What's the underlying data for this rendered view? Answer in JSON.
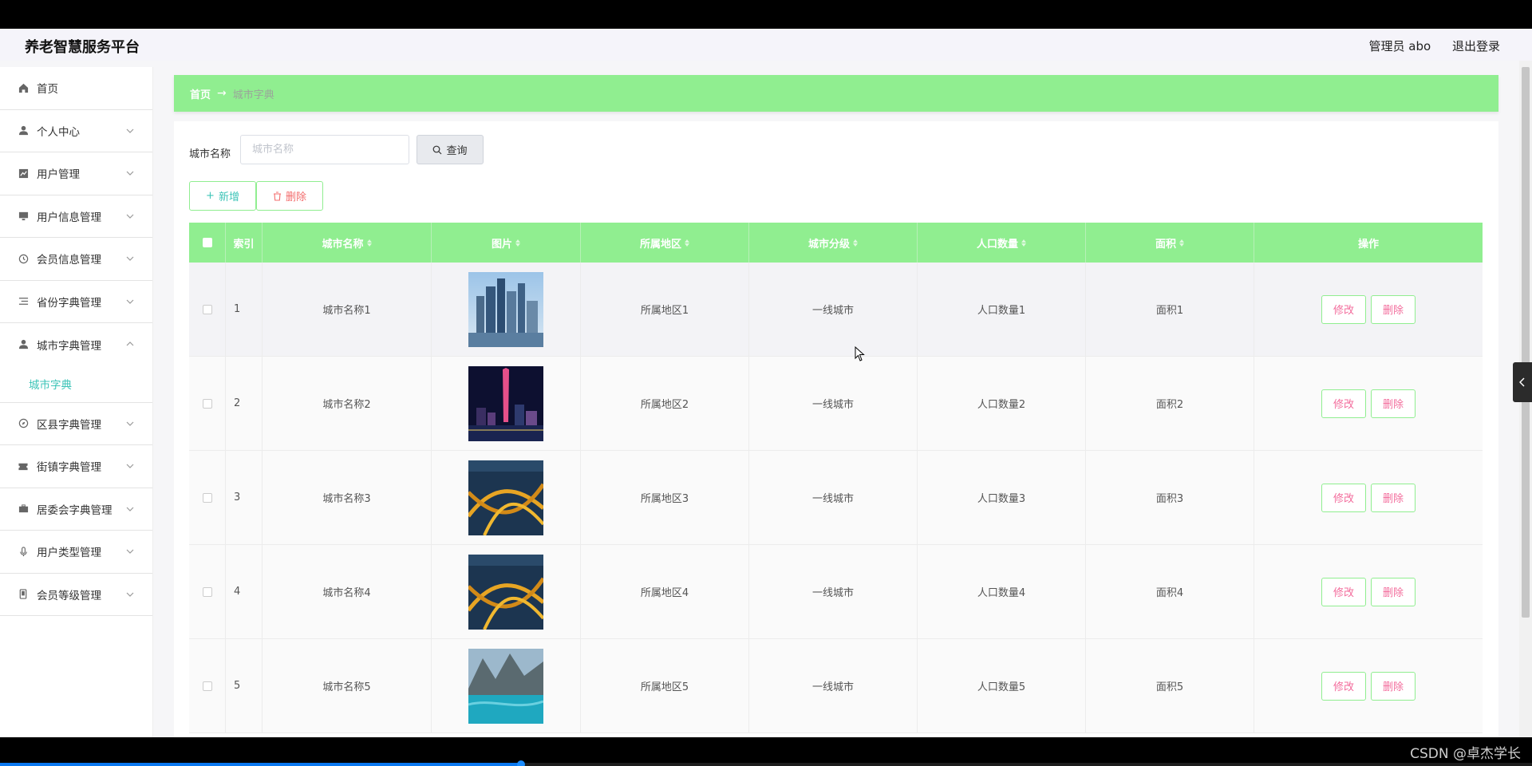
{
  "header": {
    "brand": "养老智慧服务平台",
    "admin_label": "管理员 abo",
    "logout_label": "退出登录"
  },
  "sidebar": {
    "items": [
      {
        "label": "首页",
        "icon": "home-icon"
      },
      {
        "label": "个人中心",
        "icon": "user-icon"
      },
      {
        "label": "用户管理",
        "icon": "chart-icon"
      },
      {
        "label": "用户信息管理",
        "icon": "monitor-icon"
      },
      {
        "label": "会员信息管理",
        "icon": "clock-icon"
      },
      {
        "label": "省份字典管理",
        "icon": "list-icon"
      },
      {
        "label": "城市字典管理",
        "icon": "user-icon"
      },
      {
        "label": "区县字典管理",
        "icon": "compass-icon"
      },
      {
        "label": "街镇字典管理",
        "icon": "ticket-icon"
      },
      {
        "label": "居委会字典管理",
        "icon": "briefcase-icon"
      },
      {
        "label": "用户类型管理",
        "icon": "mic-icon"
      },
      {
        "label": "会员等级管理",
        "icon": "phone-icon"
      }
    ],
    "submenu": {
      "label": "城市字典"
    }
  },
  "breadcrumb": {
    "home": "首页",
    "separator": "→",
    "current": "城市字典"
  },
  "search": {
    "label": "城市名称",
    "placeholder": "城市名称",
    "query_label": "查询"
  },
  "actions": {
    "add_label": "新增",
    "delete_label": "删除"
  },
  "table": {
    "headers": [
      "索引",
      "城市名称",
      "图片",
      "所属地区",
      "城市分级",
      "人口数量",
      "面积",
      "操作"
    ],
    "edit_label": "修改",
    "delete_label": "删除",
    "rows": [
      {
        "index": "1",
        "name": "城市名称1",
        "region": "所属地区1",
        "level": "一线城市",
        "population": "人口数量1",
        "area": "面积1"
      },
      {
        "index": "2",
        "name": "城市名称2",
        "region": "所属地区2",
        "level": "一线城市",
        "population": "人口数量2",
        "area": "面积2"
      },
      {
        "index": "3",
        "name": "城市名称3",
        "region": "所属地区3",
        "level": "一线城市",
        "population": "人口数量3",
        "area": "面积3"
      },
      {
        "index": "4",
        "name": "城市名称4",
        "region": "所属地区4",
        "level": "一线城市",
        "population": "人口数量4",
        "area": "面积4"
      },
      {
        "index": "5",
        "name": "城市名称5",
        "region": "所属地区5",
        "level": "一线城市",
        "population": "人口数量5",
        "area": "面积5"
      }
    ]
  },
  "video": {
    "watermark": "CSDN @卓杰学长",
    "progress": 0.34
  },
  "colors": {
    "accent_green": "#90ee90",
    "teal_text": "#3ec4b8",
    "danger": "#f36c6c"
  }
}
